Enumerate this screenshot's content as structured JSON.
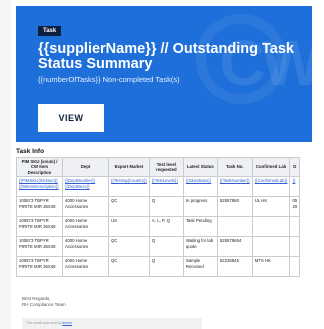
{
  "banner": {
    "tag": "Task",
    "title": "{{supplierName}} // Outstanding Task Status Summary",
    "subtitle": "{{numberOfTasks}} Non-completed Task(s)",
    "view_label": "VIEW",
    "accent": "#1e6fd9"
  },
  "section_title": "Task Info",
  "table": {
    "headers": [
      "PIM SKU (xnum) / CW Item Description",
      "Dept",
      "Export Market",
      "Test level requested",
      "Latest Status",
      "Task No.",
      "Confirmed Lab",
      "D"
    ],
    "placeholder_row": [
      "{{PIMSKU{SicNum}}{{WItemDescription}}",
      "{{DeptNumber}}{{DeptDesc}}",
      "{{Testing{Country}}",
      "{{TestLevels}}",
      "{{SkuStatus}}",
      "{{TaskNumber}}",
      "{{ConfirmedLab}}",
      "{{"
    ],
    "rows": [
      [
        "100873 TBPYR PIRITE MIR 36X48",
        "4000 Home Accessories",
        "QC",
        "Q",
        "In progress",
        "52557950",
        "UL HK",
        "05 20"
      ],
      [
        "100873 TBPYR PIRITE MIR 36X48",
        "4000 Home Accessories",
        "US",
        "A, L, P, Q",
        "Task Pending",
        "",
        "",
        ""
      ],
      [
        "100873 TBPYR PIRITE MIR 36X48",
        "4000 Home Accessories",
        "QC",
        "Q",
        "Waiting for lab quote",
        "525579654",
        "",
        ""
      ],
      [
        "100873 TBPYR PIRITE MIR 36X48",
        "4000 Home Accessories",
        "QC",
        "Q",
        "Sample Received",
        "52235845",
        "MTS HK",
        ""
      ]
    ]
  },
  "regards": {
    "line1": "Best Regards,",
    "line2": "RH Compliance Team"
  },
  "footer": {
    "text": "This email was sent by",
    "link": "lemon"
  }
}
